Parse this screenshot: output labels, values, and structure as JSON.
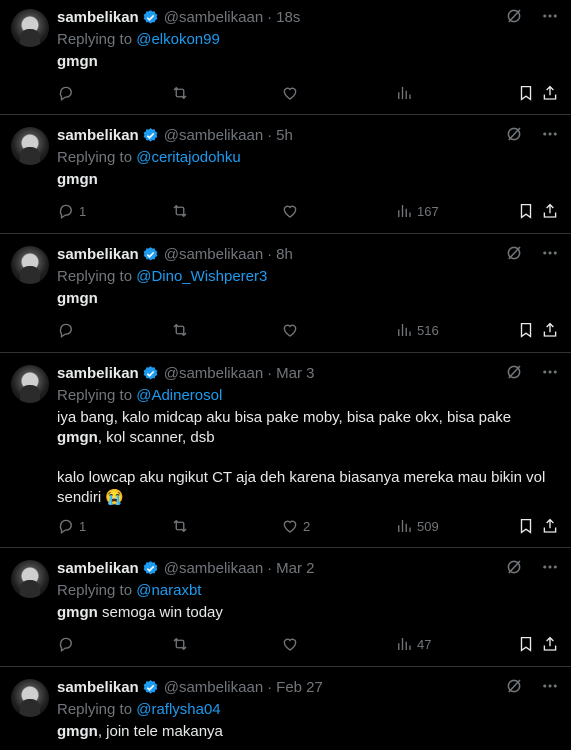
{
  "tweets": [
    {
      "name": "sambelikan",
      "handle": "@sambelikaan",
      "time": "18s",
      "replying_label": "Replying to",
      "replying_to": "@elkokon99",
      "text_bold": "gmgn",
      "text_rest": "",
      "text_extra": "",
      "emoji": "",
      "replies": "",
      "likes": "",
      "views": ""
    },
    {
      "name": "sambelikan",
      "handle": "@sambelikaan",
      "time": "5h",
      "replying_label": "Replying to",
      "replying_to": "@ceritajodohku",
      "text_bold": "gmgn",
      "text_rest": "",
      "text_extra": "",
      "emoji": "",
      "replies": "1",
      "likes": "",
      "views": "167"
    },
    {
      "name": "sambelikan",
      "handle": "@sambelikaan",
      "time": "8h",
      "replying_label": "Replying to",
      "replying_to": "@Dino_Wishperer3",
      "text_bold": "gmgn",
      "text_rest": "",
      "text_extra": "",
      "emoji": "",
      "replies": "",
      "likes": "",
      "views": "516"
    },
    {
      "name": "sambelikan",
      "handle": "@sambelikaan",
      "time": "Mar 3",
      "replying_label": "Replying to",
      "replying_to": "@Adinerosol",
      "text_pre": "iya bang, kalo midcap aku bisa pake moby, bisa pake okx, bisa pake ",
      "text_bold": "gmgn",
      "text_rest": ", kol scanner, dsb",
      "text_extra": "kalo lowcap aku ngikut CT aja deh karena biasanya mereka mau bikin vol sendiri",
      "emoji": "😭",
      "replies": "1",
      "likes": "2",
      "views": "509"
    },
    {
      "name": "sambelikan",
      "handle": "@sambelikaan",
      "time": "Mar 2",
      "replying_label": "Replying to",
      "replying_to": "@naraxbt",
      "text_bold": "gmgn",
      "text_rest": " semoga win today",
      "text_extra": "",
      "emoji": "",
      "replies": "",
      "likes": "",
      "views": "47"
    },
    {
      "name": "sambelikan",
      "handle": "@sambelikaan",
      "time": "Feb 27",
      "replying_label": "Replying to",
      "replying_to": "@raflysha04",
      "text_bold": "gmgn",
      "text_rest": ", join tele makanya",
      "text_extra": "",
      "emoji": "",
      "replies": "",
      "likes": "",
      "views": ""
    }
  ],
  "separator": "·",
  "colors": {
    "background": "#000000",
    "text": "#e7e9ea",
    "muted": "#71767b",
    "accent": "#1d9bf0",
    "border": "#2f3336"
  }
}
